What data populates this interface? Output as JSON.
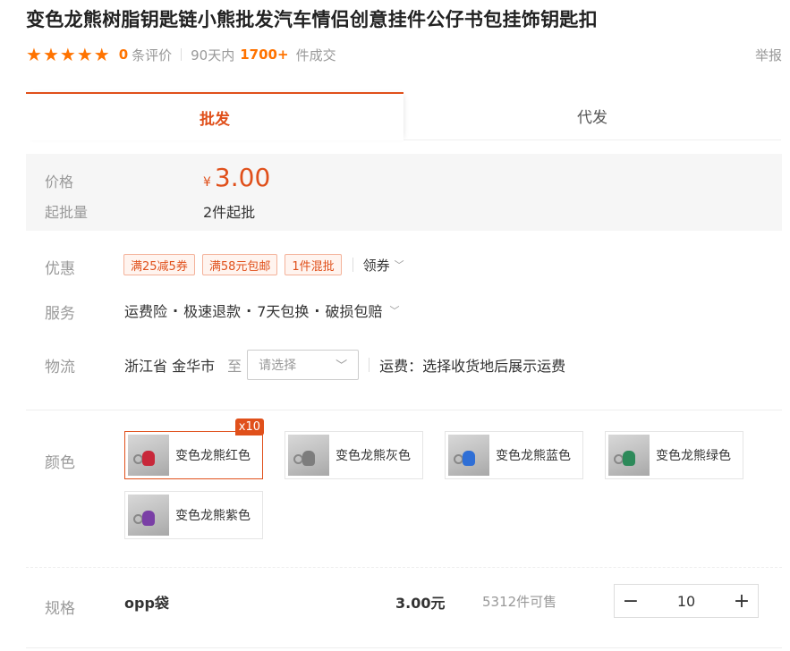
{
  "product": {
    "title": "变色龙熊树脂钥匙链小熊批发汽车情侣创意挂件公仔书包挂饰钥匙扣",
    "rating_stars": 5,
    "review_count": "0",
    "review_label": "条评价",
    "sales_period": "90天内",
    "sales_count": "1700+",
    "sales_label": "件成交",
    "report_label": "举报"
  },
  "tabs": [
    {
      "label": "批发",
      "active": true
    },
    {
      "label": "代发",
      "active": false
    }
  ],
  "pricing": {
    "price_label": "价格",
    "currency": "¥",
    "price": "3.00",
    "moq_label": "起批量",
    "moq_value": "2件起批"
  },
  "promotions": {
    "label": "优惠",
    "tags": [
      "满25减5券",
      "满58元包邮",
      "1件混批"
    ],
    "coupon_label": "领券"
  },
  "services": {
    "label": "服务",
    "items": [
      "运费险",
      "极速退款",
      "7天包换",
      "破损包赔"
    ]
  },
  "logistics": {
    "label": "物流",
    "origin": "浙江省 金华市",
    "to_label": "至",
    "select_placeholder": "请选择",
    "fee_text": "运费：选择收货地后展示运费"
  },
  "colors": {
    "label": "颜色",
    "options": [
      {
        "name": "变色龙熊红色",
        "selected": true,
        "badge": "x10",
        "swatch": "#c8283a"
      },
      {
        "name": "变色龙熊灰色",
        "selected": false,
        "badge": "",
        "swatch": "#7d7d7d"
      },
      {
        "name": "变色龙熊蓝色",
        "selected": false,
        "badge": "",
        "swatch": "#2f6fd6"
      },
      {
        "name": "变色龙熊绿色",
        "selected": false,
        "badge": "",
        "swatch": "#2d8a5a"
      },
      {
        "name": "变色龙熊紫色",
        "selected": false,
        "badge": "",
        "swatch": "#7a3fa6"
      }
    ]
  },
  "spec": {
    "label": "规格",
    "name": "opp袋",
    "price": "3.00元",
    "stock": "5312件可售",
    "quantity": "10",
    "minus": "−",
    "plus": "+"
  },
  "theme": {
    "accent": "#e0501b",
    "star": "#ff7300"
  }
}
